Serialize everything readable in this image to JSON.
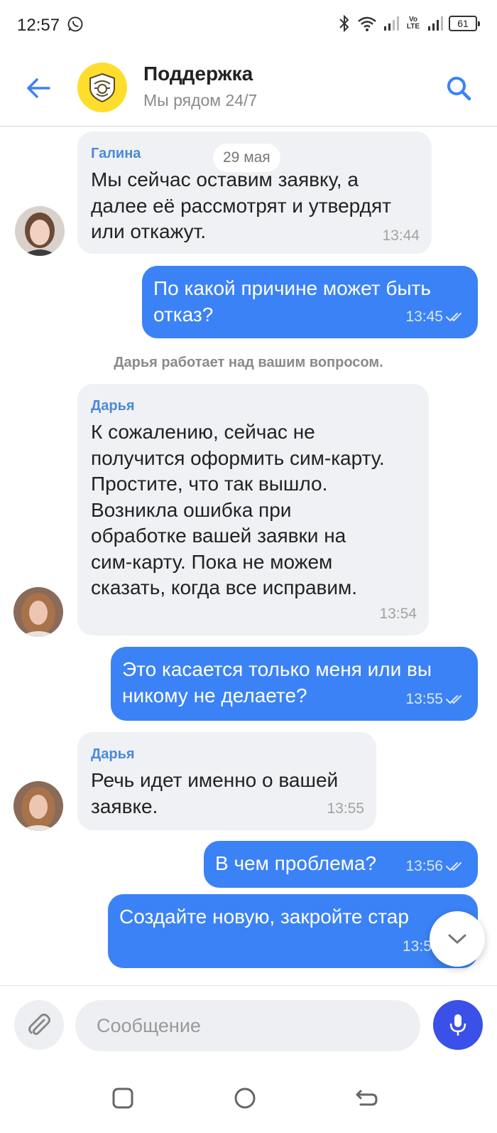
{
  "status_bar": {
    "time": "12:57",
    "battery": "61",
    "network": "Vo LTE"
  },
  "header": {
    "title": "Поддержка",
    "subtitle": "Мы рядом 24/7",
    "accent_color": "#3b82f6",
    "logo_color": "#ffdd2d"
  },
  "chat": {
    "date_separator": "29 мая",
    "system_notice": "Дарья работает над вашим вопросом.",
    "messages": [
      {
        "direction": "incoming",
        "sender": "Галина",
        "text": "Мы сейчас оставим заявку, а\nдалее её рассмотрят и утвердят\nили откажут.",
        "time": "13:44"
      },
      {
        "direction": "outgoing",
        "text": "По какой причине может быть\nотказ?",
        "time": "13:45",
        "status": "read"
      },
      {
        "direction": "incoming",
        "sender": "Дарья",
        "text": "К сожалению, сейчас не\nполучится оформить сим-карту.\nПростите, что так вышло.\nВозникла ошибка при\nобработке вашей заявки на\nсим-карту. Пока не можем\nсказать, когда все исправим.",
        "time": "13:54"
      },
      {
        "direction": "outgoing",
        "text": "Это касается только меня или вы\nникому не делаете?",
        "time": "13:55",
        "status": "read"
      },
      {
        "direction": "incoming",
        "sender": "Дарья",
        "text": "Речь идет именно о вашей\nзаявке.",
        "time": "13:55"
      },
      {
        "direction": "outgoing",
        "text": "В чем проблема?",
        "time": "13:56",
        "status": "read"
      },
      {
        "direction": "outgoing",
        "text": "Создайте новую, закройте стар",
        "time": "13:5",
        "status": "read"
      }
    ]
  },
  "composer": {
    "placeholder": "Сообщение"
  },
  "icons": {
    "back": "arrow-left-icon",
    "search": "search-icon",
    "attach": "paperclip-icon",
    "mic": "microphone-icon",
    "scroll_down": "chevron-down-icon"
  }
}
